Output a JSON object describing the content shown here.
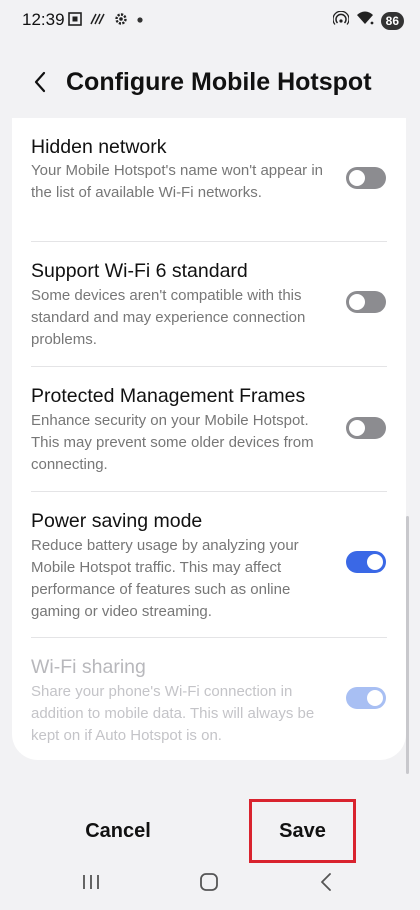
{
  "status_bar": {
    "time": "12:39",
    "battery": "86",
    "icons": [
      "screenshot-icon",
      "bandwidth-icon",
      "settings-gear-icon",
      "notification-dot-icon",
      "hotspot-icon",
      "wifi-icon",
      "battery-icon"
    ]
  },
  "header": {
    "title": "Configure Mobile Hotspot",
    "back_icon": "chevron-left-icon"
  },
  "settings": [
    {
      "title": "Hidden network",
      "description": "Your Mobile Hotspot's name won't appear in the list of available Wi-Fi networks.",
      "enabled": false
    },
    {
      "title": "Support Wi-Fi 6 standard",
      "description": "Some devices aren't compatible with this standard and may experience connection problems.",
      "enabled": false
    },
    {
      "title": "Protected Management Frames",
      "description": "Enhance security on your Mobile Hotspot. This may prevent some older devices from connecting.",
      "enabled": false
    },
    {
      "title": "Power saving mode",
      "description": "Reduce battery usage by analyzing your Mobile Hotspot traffic. This may affect performance of features such as online gaming or video streaming.",
      "enabled": true
    },
    {
      "title": "Wi-Fi sharing",
      "description": "Share your phone's Wi-Fi connection in addition to mobile data. This will always be kept on if Auto Hotspot is on.",
      "enabled": true,
      "disabled": true
    }
  ],
  "buttons": {
    "cancel_label": "Cancel",
    "save_label": "Save"
  },
  "colors": {
    "accent": "#3a68e6",
    "highlight_border": "#d9232e"
  },
  "nav_bar": {
    "icons": [
      "recent-apps-icon",
      "home-icon",
      "back-icon"
    ]
  }
}
